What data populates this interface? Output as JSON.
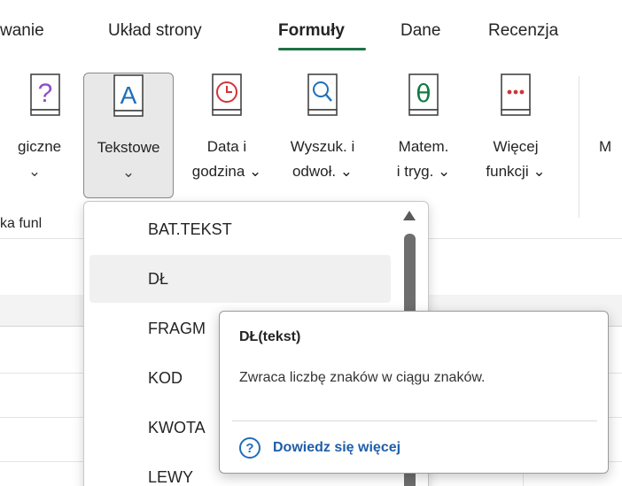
{
  "tabs": [
    {
      "label": "wanie"
    },
    {
      "label": "Układ strony"
    },
    {
      "label": "Formuły"
    },
    {
      "label": "Dane"
    },
    {
      "label": "Recenzja"
    }
  ],
  "ribbon": {
    "buttons": {
      "logical": {
        "l1": "giczne",
        "chev": "⌄",
        "icon": "logical-icon"
      },
      "text": {
        "l1": "Tekstowe",
        "chev": "⌄",
        "icon": "text-icon"
      },
      "datetime": {
        "l1": "Data i",
        "l2": "godzina ⌄",
        "icon": "clock-icon"
      },
      "lookup": {
        "l1": "Wyszuk. i",
        "l2": "odwoł. ⌄",
        "icon": "magnifier-icon"
      },
      "math": {
        "l1": "Matem.",
        "l2": "i tryg. ⌄",
        "icon": "theta-icon"
      },
      "more": {
        "l1": "Więcej",
        "l2": "funkcji ⌄",
        "icon": "more-functions-icon"
      }
    },
    "next_group_label": "M",
    "group_label": "ka funl"
  },
  "dropdown": {
    "items": [
      {
        "label": "BAT.TEKST"
      },
      {
        "label": "DŁ"
      },
      {
        "label": "FRAGM"
      },
      {
        "label": "KOD"
      },
      {
        "label": "KWOTA"
      },
      {
        "label": "LEWY"
      }
    ],
    "hover_index": 1
  },
  "tooltip": {
    "title": "DŁ(tekst)",
    "description": "Zwraca liczbę znaków w ciągu znaków.",
    "help_symbol": "?",
    "link": "Dowiedz się więcej"
  },
  "colors": {
    "accent": "#1e7145",
    "link": "#1f5ea8",
    "icon_red": "#d13438",
    "icon_blue": "#1f6fb8",
    "icon_green": "#107c41",
    "icon_purple": "#8a4fc8"
  }
}
